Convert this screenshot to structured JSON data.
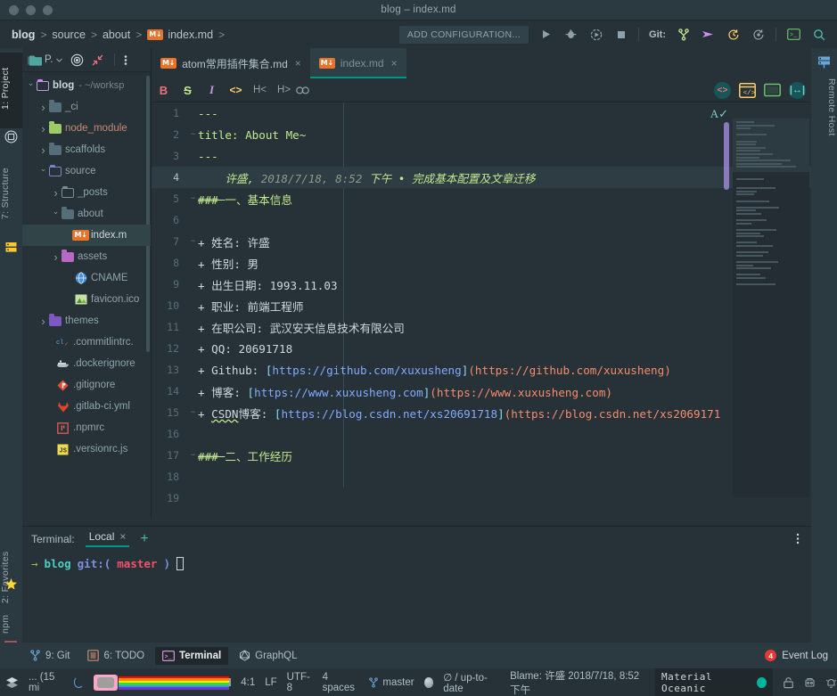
{
  "window": {
    "title": "blog – index.md"
  },
  "breadcrumb": {
    "items": [
      {
        "label": "blog",
        "icon": ""
      },
      {
        "label": "source",
        "icon": ""
      },
      {
        "label": "about",
        "icon": ""
      },
      {
        "label": "index.md",
        "icon": "md-file-icon"
      }
    ],
    "separator": ">"
  },
  "navbar": {
    "add_configuration": "ADD CONFIGURATION...",
    "git_label": "Git:",
    "icons": [
      "run-icon",
      "debug-icon",
      "run-with-coverage-icon",
      "stop-icon",
      "git-branch-icon",
      "git-push-icon",
      "git-history-icon",
      "git-rollback-icon",
      "terminal-icon",
      "search-everywhere-icon"
    ]
  },
  "left_strip": {
    "tabs": [
      {
        "label": "1: Project",
        "active": true
      },
      {
        "label": "7: Structure",
        "active": false
      },
      {
        "label": "2: Favorites",
        "active": false
      },
      {
        "label": "npm",
        "active": false
      }
    ]
  },
  "right_strip": {
    "tabs": [
      {
        "label": "Remote Host"
      }
    ]
  },
  "project_panel": {
    "title": "P.",
    "buttons": [
      "locate-icon",
      "collapse-all-icon",
      "more-options-icon"
    ],
    "tree": [
      {
        "indent": 0,
        "arrow": "down",
        "icon": "folder-outline-violet",
        "label": "blog",
        "bold": true,
        "hint": "- ~/worksp"
      },
      {
        "indent": 1,
        "arrow": "right",
        "icon": "folder-grey",
        "label": "_ci"
      },
      {
        "indent": 1,
        "arrow": "right",
        "icon": "folder-green",
        "label": "node_module"
      },
      {
        "indent": 1,
        "arrow": "right",
        "icon": "folder-grey",
        "label": "scaffolds"
      },
      {
        "indent": 1,
        "arrow": "down",
        "icon": "folder-source-blue",
        "label": "source"
      },
      {
        "indent": 2,
        "arrow": "right",
        "icon": "folder-outline-grey",
        "label": "_posts"
      },
      {
        "indent": 2,
        "arrow": "down",
        "icon": "folder-grey",
        "label": "about"
      },
      {
        "indent": 3,
        "arrow": "none",
        "icon": "md-file-icon",
        "label": "index.m",
        "selected": true
      },
      {
        "indent": 2,
        "arrow": "right",
        "icon": "folder-magenta",
        "label": "assets"
      },
      {
        "indent": 3,
        "arrow": "none",
        "icon": "globe-icon",
        "label": "CNAME"
      },
      {
        "indent": 3,
        "arrow": "none",
        "icon": "image-icon",
        "label": "favicon.ico"
      },
      {
        "indent": 1,
        "arrow": "right",
        "icon": "folder-purple",
        "label": "themes"
      },
      {
        "indent": 2,
        "arrow": "none",
        "icon": "commitlint-icon",
        "label": ".commitlintrc."
      },
      {
        "indent": 2,
        "arrow": "none",
        "icon": "docker-icon",
        "label": ".dockerignore"
      },
      {
        "indent": 2,
        "arrow": "none",
        "icon": "git-icon",
        "label": ".gitignore"
      },
      {
        "indent": 2,
        "arrow": "none",
        "icon": "gitlab-icon",
        "label": ".gitlab-ci.yml"
      },
      {
        "indent": 2,
        "arrow": "none",
        "icon": "npm-icon",
        "label": ".npmrc"
      },
      {
        "indent": 2,
        "arrow": "none",
        "icon": "js-icon",
        "label": ".versionrc.js"
      }
    ]
  },
  "editor_tabs": [
    {
      "label": "atom常用插件集合.md",
      "icon": "md-file-icon",
      "active": false,
      "close": "×"
    },
    {
      "label": "index.md",
      "icon": "md-file-icon",
      "active": true,
      "close": "×"
    }
  ],
  "md_toolbar": {
    "buttons": [
      {
        "name": "bold-button",
        "glyph": "B",
        "color": "#f07178"
      },
      {
        "name": "strikethrough-button",
        "glyph": "S",
        "color": "#c3e88d"
      },
      {
        "name": "italic-button",
        "glyph": "I",
        "color": "#c792ea"
      },
      {
        "name": "code-button",
        "glyph": "<>",
        "color": "#ffcb6b"
      },
      {
        "name": "heading-up-button",
        "glyph": "H<",
        "color": "#8fa1aa"
      },
      {
        "name": "heading-down-button",
        "glyph": "H>",
        "color": "#8fa1aa"
      },
      {
        "name": "link-button",
        "glyph": "🔗",
        "color": "#8fa1aa"
      }
    ],
    "right_buttons": [
      "html-preview-icon",
      "browser-preview-icon",
      "preview-panel-icon",
      "split-editor-icon"
    ]
  },
  "editor": {
    "lines": [
      {
        "no": "1",
        "fold": "",
        "segments": [
          {
            "t": "---",
            "c": "c-green"
          }
        ]
      },
      {
        "no": "2",
        "fold": "−",
        "segments": [
          {
            "t": "title: About Me~",
            "c": "c-green"
          }
        ]
      },
      {
        "no": "3",
        "fold": "",
        "segments": [
          {
            "t": "---",
            "c": "c-green"
          }
        ]
      },
      {
        "no": "4",
        "fold": "",
        "blame": true,
        "segments": [
          {
            "t": "    许盛, ",
            "c": "c-blamename"
          },
          {
            "t": "2018/7/18, 8:52 ",
            "c": "c-blame"
          },
          {
            "t": "下午 • 完成基本配置及文章迁移",
            "c": "c-blamename"
          }
        ]
      },
      {
        "no": "5",
        "fold": "−",
        "segments": [
          {
            "t": "### ",
            "c": "c-green strike"
          },
          {
            "t": "一、基本信息",
            "c": "c-green"
          }
        ]
      },
      {
        "no": "6",
        "fold": "",
        "segments": []
      },
      {
        "no": "7",
        "fold": "−",
        "segments": [
          {
            "t": "+ ",
            "c": "c-white"
          },
          {
            "t": "姓名: 许盛",
            "c": "c-white"
          }
        ]
      },
      {
        "no": "8",
        "fold": "",
        "segments": [
          {
            "t": "+ 性别: 男",
            "c": "c-white"
          }
        ]
      },
      {
        "no": "9",
        "fold": "",
        "segments": [
          {
            "t": "+ 出生日期: 1993.11.03",
            "c": "c-white"
          }
        ]
      },
      {
        "no": "10",
        "fold": "",
        "segments": [
          {
            "t": "+ 职业: 前端工程师",
            "c": "c-white"
          }
        ]
      },
      {
        "no": "11",
        "fold": "",
        "segments": [
          {
            "t": "+ 在职公司: 武汉安天信息技术有限公司",
            "c": "c-white"
          }
        ]
      },
      {
        "no": "12",
        "fold": "",
        "segments": [
          {
            "t": "+ QQ: 20691718",
            "c": "c-white"
          }
        ]
      },
      {
        "no": "13",
        "fold": "",
        "segments": [
          {
            "t": "+ Github: ",
            "c": "c-white"
          },
          {
            "t": "[",
            "c": "c-punct"
          },
          {
            "t": "https://github.com/xuxusheng",
            "c": "c-blue"
          },
          {
            "t": "]",
            "c": "c-punct"
          },
          {
            "t": "(https://github.com/xuxusheng)",
            "c": "c-orange"
          }
        ]
      },
      {
        "no": "14",
        "fold": "",
        "segments": [
          {
            "t": "+ 博客: ",
            "c": "c-white"
          },
          {
            "t": "[",
            "c": "c-punct"
          },
          {
            "t": "https://www.xuxusheng.com",
            "c": "c-blue"
          },
          {
            "t": "]",
            "c": "c-punct"
          },
          {
            "t": "(https://www.xuxusheng.com)",
            "c": "c-orange"
          }
        ]
      },
      {
        "no": "15",
        "fold": "−",
        "segments": [
          {
            "t": "+ ",
            "c": "c-white"
          },
          {
            "t": "CSDN",
            "c": "c-white wavy"
          },
          {
            "t": "博客: ",
            "c": "c-white"
          },
          {
            "t": "[",
            "c": "c-punct"
          },
          {
            "t": "https://blog.csdn.net/xs20691718",
            "c": "c-blue"
          },
          {
            "t": "]",
            "c": "c-punct"
          },
          {
            "t": "(https://blog.csdn.net/xs2069171",
            "c": "c-orange"
          }
        ]
      },
      {
        "no": "16",
        "fold": "",
        "segments": []
      },
      {
        "no": "17",
        "fold": "−",
        "segments": [
          {
            "t": "### ",
            "c": "c-green strike"
          },
          {
            "t": "二、工作经历",
            "c": "c-green"
          }
        ]
      },
      {
        "no": "18",
        "fold": "",
        "segments": []
      },
      {
        "no": "19",
        "fold": "",
        "segments": []
      }
    ]
  },
  "terminal": {
    "label": "Terminal:",
    "tab": "Local",
    "tab_close": "×",
    "new_tab": "+",
    "prompt_arrow": "→",
    "prompt_dir": "blog",
    "prompt_git": "git:(",
    "prompt_branch": "master",
    "prompt_git_close": ")"
  },
  "bottom_bar": {
    "items": [
      {
        "label": "9: Git",
        "key": "9",
        "icon": "git-branch-icon",
        "active": false
      },
      {
        "label": "6: TODO",
        "key": "6",
        "icon": "todo-icon",
        "active": false
      },
      {
        "label": "Terminal",
        "key": "",
        "icon": "terminal-icon",
        "active": true
      },
      {
        "label": "GraphQL",
        "key": "",
        "icon": "graphql-icon",
        "active": false
      }
    ],
    "event_log": {
      "label": "Event Log",
      "count": "4"
    }
  },
  "status_bar": {
    "memory": "... (15 mi",
    "caret": "4:1",
    "line_sep": "LF",
    "encoding": "UTF-8",
    "indent": "4 spaces",
    "branch": "master",
    "vcs_status": "∅ / up-to-date",
    "blame": "Blame: 许盛 2018/7/18, 8:52 下午",
    "theme": "Material Oceanic",
    "icons": [
      "layers-icon",
      "lock-icon",
      "inspector-icon",
      "notification-icon"
    ]
  },
  "colors": {
    "background": "#263238",
    "panel": "#2b3940",
    "accent_teal": "#009688",
    "md_badge_orange": "#e8742c",
    "selection_violet": "#9c84d4",
    "green_text": "#c3e88d",
    "blue_text": "#82aaff",
    "orange_text": "#f78c6c"
  }
}
